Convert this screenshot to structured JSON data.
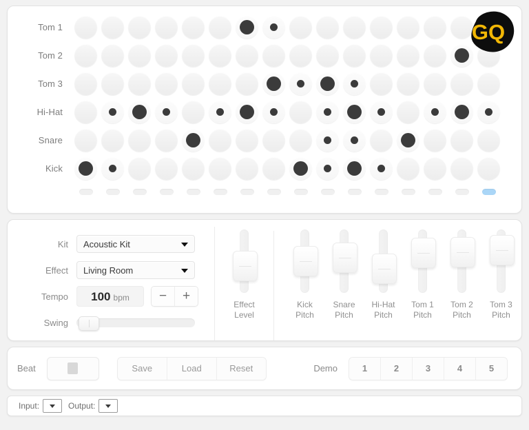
{
  "sequencer": {
    "rows": [
      {
        "label": "Tom 1",
        "steps": [
          0,
          0,
          0,
          0,
          0,
          0,
          2,
          1,
          0,
          0,
          0,
          0,
          0,
          0,
          0,
          0
        ]
      },
      {
        "label": "Tom 2",
        "steps": [
          0,
          0,
          0,
          0,
          0,
          0,
          0,
          0,
          0,
          0,
          0,
          0,
          0,
          0,
          2,
          0
        ]
      },
      {
        "label": "Tom 3",
        "steps": [
          0,
          0,
          0,
          0,
          0,
          0,
          0,
          2,
          1,
          2,
          1,
          0,
          0,
          0,
          0,
          0
        ]
      },
      {
        "label": "Hi-Hat",
        "steps": [
          0,
          1,
          2,
          1,
          0,
          1,
          2,
          1,
          0,
          1,
          2,
          1,
          0,
          1,
          2,
          1
        ]
      },
      {
        "label": "Snare",
        "steps": [
          0,
          0,
          0,
          0,
          2,
          0,
          0,
          0,
          0,
          1,
          1,
          0,
          2,
          0,
          0,
          0
        ]
      },
      {
        "label": "Kick",
        "steps": [
          2,
          1,
          0,
          0,
          0,
          0,
          0,
          0,
          2,
          1,
          2,
          1,
          0,
          0,
          0,
          0
        ]
      }
    ],
    "step_count": 16,
    "active_step": 15,
    "active_step_color": "#aad6f7"
  },
  "logo": {
    "text": "GQ",
    "text_color": "#f2b705",
    "blob_color": "#0d0d0d"
  },
  "controls": {
    "kit": {
      "label": "Kit",
      "value": "Acoustic Kit"
    },
    "effect": {
      "label": "Effect",
      "value": "Living Room"
    },
    "tempo": {
      "label": "Tempo",
      "value": "100",
      "unit": "bpm",
      "decrement": "−",
      "increment": "+"
    },
    "swing": {
      "label": "Swing",
      "percent": 4
    }
  },
  "sliders": [
    {
      "name_line1": "Effect",
      "name_line2": "Level",
      "percent": 38
    },
    {
      "name_line1": "Kick",
      "name_line2": "Pitch",
      "percent": 52
    },
    {
      "name_line1": "Snare",
      "name_line2": "Pitch",
      "percent": 62
    },
    {
      "name_line1": "Hi-Hat",
      "name_line2": "Pitch",
      "percent": 30
    },
    {
      "name_line1": "Tom 1",
      "name_line2": "Pitch",
      "percent": 76
    },
    {
      "name_line1": "Tom 2",
      "name_line2": "Pitch",
      "percent": 78
    },
    {
      "name_line1": "Tom 3",
      "name_line2": "Pitch",
      "percent": 84
    }
  ],
  "transport": {
    "beat_label": "Beat",
    "beat_icon": "stop-icon",
    "file_buttons": [
      "Save",
      "Load",
      "Reset"
    ],
    "demo_label": "Demo",
    "demo_buttons": [
      "1",
      "2",
      "3",
      "4",
      "5"
    ]
  },
  "io": {
    "input_label": "Input:",
    "input_value": "",
    "output_label": "Output:",
    "output_value": ""
  }
}
